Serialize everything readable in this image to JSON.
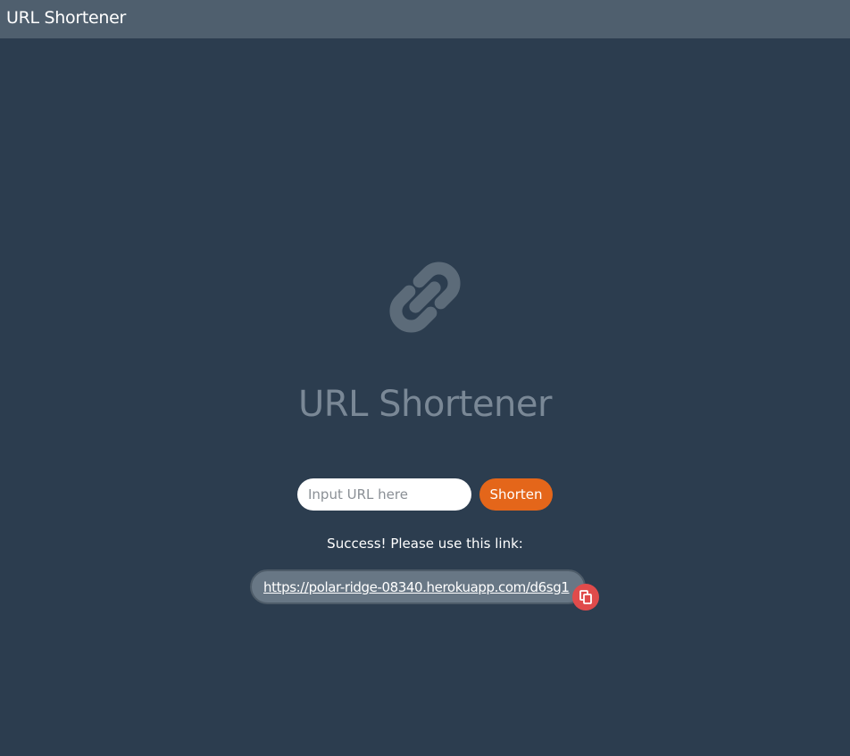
{
  "app": {
    "title": "URL Shortener"
  },
  "hero": {
    "icon": "link-icon",
    "title": "URL Shortener"
  },
  "form": {
    "input_value": "",
    "input_placeholder": "Input URL here",
    "submit_label": "Shorten"
  },
  "result": {
    "message": "Success! Please use this link:",
    "short_url": "https://polar-ridge-08340.herokuapp.com/d6sg1",
    "copy_icon": "copy-icon"
  },
  "colors": {
    "background": "#2c3d4f",
    "topbar": "#4f5f6e",
    "accent": "#e4661a",
    "copy_button": "#e04b4b"
  }
}
